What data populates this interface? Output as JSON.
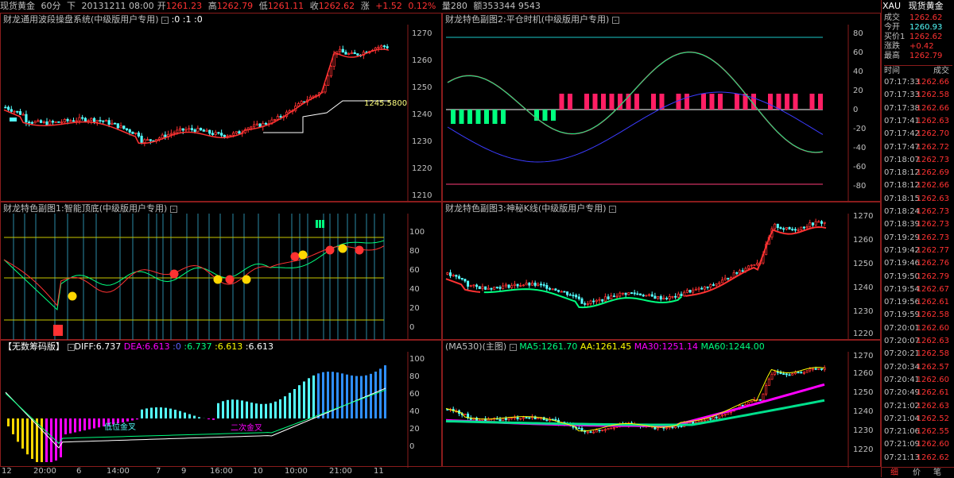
{
  "header": {
    "name": "现货黄金",
    "period": "60分",
    "direction": "下",
    "datetime": "20131211 08:00",
    "open_label": "开",
    "open": "1261.23",
    "high_label": "高",
    "high": "1262.79",
    "low_label": "低",
    "low": "1261.11",
    "close_label": "收",
    "close": "1262.62",
    "change_label": "涨",
    "change": "+1.52",
    "change_pct": "0.12%",
    "volume_label": "量",
    "volume": "280",
    "amount_label": "额",
    "amount": "353344 9543"
  },
  "main_panel": {
    "title": "财龙通用波段操盘系统(中级版用户专用)",
    "values": ":0 :1 :0",
    "annotation": "1245.5800",
    "axis": [
      "1270",
      "1260",
      "1250",
      "1240",
      "1230",
      "1220",
      "1210"
    ]
  },
  "sub1": {
    "title": "财龙特色副图1:智能顶底(中级版用户专用)",
    "axis": [
      "100",
      "80",
      "60",
      "40",
      "20",
      "0"
    ]
  },
  "sub_macd": {
    "title": "【无数筹码版】",
    "diff_label": "DIFF:6.737",
    "dea_label": "DEA:6.613",
    "v1": ":0",
    "v2": ":6.737",
    "v3": ":6.613",
    "v4": ":6.613",
    "label_low": "低位金叉",
    "label_second": "二次金叉",
    "axis": [
      "100",
      "80",
      "60",
      "40",
      "20",
      "0"
    ]
  },
  "sub2": {
    "title": "财龙特色副图2:平仓时机(中级版用户专用)",
    "axis": [
      "80",
      "60",
      "40",
      "20",
      "0",
      "-20",
      "-40",
      "-60",
      "-80"
    ]
  },
  "sub3": {
    "title": "财龙特色副图3:神秘K线(中级版用户专用)",
    "axis": [
      "1270",
      "1260",
      "1250",
      "1240",
      "1230",
      "1220"
    ]
  },
  "ma_panel": {
    "title": "(MA530)(主图)",
    "ma5": "MA5:1261.70",
    "aa": "AA:1261.45",
    "ma30": "MA30:1251.14",
    "ma60": "MA60:1244.00",
    "axis": [
      "1270",
      "1260",
      "1250",
      "1240",
      "1230",
      "1220"
    ]
  },
  "time_axis": [
    "12",
    "20:00",
    "6",
    "14:00",
    "7",
    "9",
    "16:00",
    "10",
    "10:00",
    "21:00",
    "11"
  ],
  "right_panel": {
    "code": "XAU",
    "name": "现货黄金",
    "quotes": [
      {
        "label": "成交",
        "value": "1262.62"
      },
      {
        "label": "今开",
        "value": "1260.93"
      },
      {
        "label": "买价1",
        "value": "1262.62"
      },
      {
        "label": "涨跌",
        "value": "+0.42"
      },
      {
        "label": "最高",
        "value": "1262.79"
      }
    ],
    "trade_header_time": "时间",
    "trade_header_price": "成交",
    "trades": [
      {
        "t": "07:17:33",
        "p": "1262.66"
      },
      {
        "t": "07:17:33",
        "p": "1262.58"
      },
      {
        "t": "07:17:38",
        "p": "1262.66"
      },
      {
        "t": "07:17:41",
        "p": "1262.63"
      },
      {
        "t": "07:17:42",
        "p": "1262.70"
      },
      {
        "t": "07:17:47",
        "p": "1262.72"
      },
      {
        "t": "07:18:07",
        "p": "1262.73"
      },
      {
        "t": "07:18:12",
        "p": "1262.69"
      },
      {
        "t": "07:18:12",
        "p": "1262.66"
      },
      {
        "t": "07:18:15",
        "p": "1262.63"
      },
      {
        "t": "07:18:24",
        "p": "1262.73"
      },
      {
        "t": "07:18:39",
        "p": "1262.73"
      },
      {
        "t": "07:19:29",
        "p": "1262.73"
      },
      {
        "t": "07:19:42",
        "p": "1262.77"
      },
      {
        "t": "07:19:46",
        "p": "1262.76"
      },
      {
        "t": "07:19:50",
        "p": "1262.79"
      },
      {
        "t": "07:19:54",
        "p": "1262.67"
      },
      {
        "t": "07:19:56",
        "p": "1262.61"
      },
      {
        "t": "07:19:59",
        "p": "1262.58"
      },
      {
        "t": "07:20:01",
        "p": "1262.60"
      },
      {
        "t": "07:20:07",
        "p": "1262.63"
      },
      {
        "t": "07:20:21",
        "p": "1262.58"
      },
      {
        "t": "07:20:34",
        "p": "1262.57"
      },
      {
        "t": "07:20:41",
        "p": "1262.60"
      },
      {
        "t": "07:20:49",
        "p": "1262.61"
      },
      {
        "t": "07:21:02",
        "p": "1262.63"
      },
      {
        "t": "07:21:04",
        "p": "1262.52"
      },
      {
        "t": "07:21:06",
        "p": "1262.55"
      },
      {
        "t": "07:21:09",
        "p": "1262.60"
      },
      {
        "t": "07:21:13",
        "p": "1262.62"
      }
    ],
    "tabs": [
      "细",
      "价",
      "笔"
    ]
  },
  "colors": {
    "panel_border": "#8a1c1c",
    "up": "#ff3232",
    "down": "#54ffff",
    "yellow": "#ffff00",
    "magenta": "#ff00ff",
    "green": "#00ff7f",
    "blue": "#3b3bff"
  }
}
